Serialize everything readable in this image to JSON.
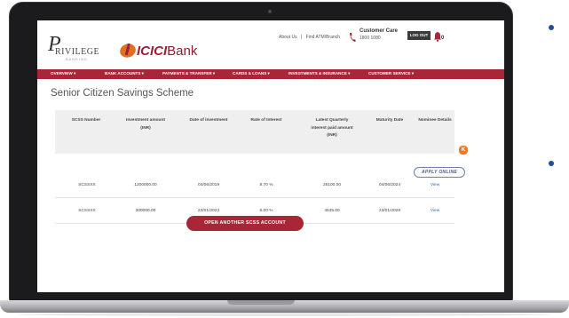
{
  "header": {
    "privilege_logo": "RIVILEGE",
    "privilege_logo_initial": "P",
    "privilege_sub": "BANKING",
    "bank_name": "ICICI",
    "bank_suffix": "Bank",
    "top_links": [
      "About Us",
      "|",
      "Find ATM/Branch"
    ],
    "customer_care_label": "Customer Care",
    "customer_care_number": "1800 1080",
    "logout_label": "LOG OUT",
    "notification_count": "0"
  },
  "nav": {
    "items": [
      "OVERVIEW ▾",
      "BANK ACCOUNTS ▾",
      "PAYMENTS & TRANSFER ▾",
      "CARDS & LOANS ▾",
      "INVESTMENTS & INSURANCE ▾",
      "CUSTOMER SERVICE ▾"
    ]
  },
  "page": {
    "title": "Senior Citizen Savings Scheme"
  },
  "table": {
    "headers": [
      [
        "SCSS Number"
      ],
      [
        "Investment amount",
        "(INR)"
      ],
      [
        "Date of investment"
      ],
      [
        "Rate of Interest"
      ],
      [
        "Latest Quarterly",
        "interest paid amount",
        "(INR)"
      ],
      [
        "Maturity Date"
      ],
      [
        "Nominee Details"
      ]
    ],
    "rows": [
      [
        "SCSSXX",
        "1200000.00",
        "04/06/2019",
        "8.70 %",
        "26100.00",
        "04/06/2024",
        "View"
      ],
      [
        "SCSSXX",
        "300000.00",
        "23/01/2023",
        "8.00 %",
        "4535.00",
        "23/01/2028",
        "View"
      ]
    ]
  },
  "actions": {
    "apply_online": "APPLY ONLINE",
    "open_another": "OPEN ANOTHER SCSS ACCOUNT",
    "chat_icon": "K"
  },
  "colors": {
    "brand": "#a82636",
    "link": "#2b6cb0",
    "bullet": "#1f4e9b"
  }
}
